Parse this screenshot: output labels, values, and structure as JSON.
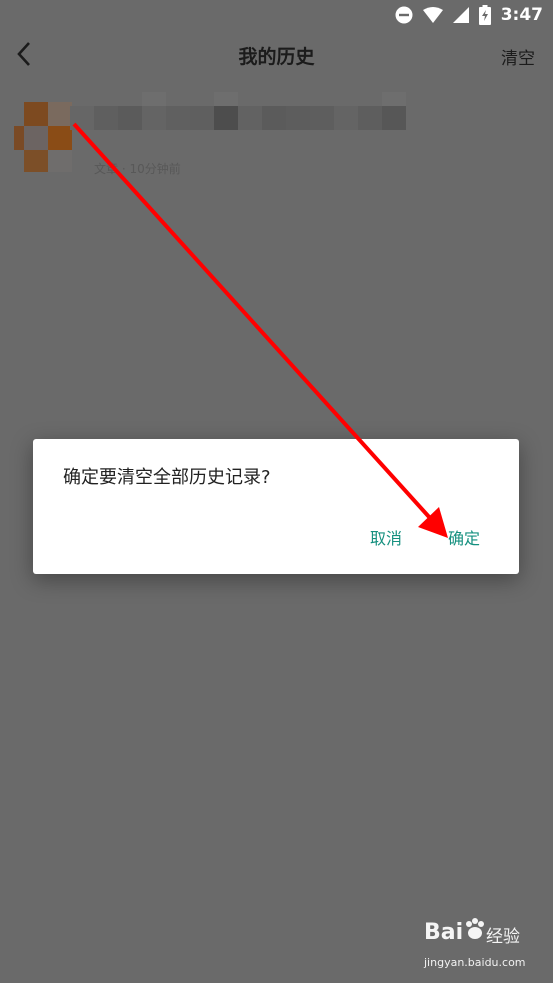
{
  "status_bar": {
    "time": "3:47"
  },
  "header": {
    "title": "我的历史",
    "clear_label": "清空"
  },
  "history_item": {
    "meta": "文章 · 10分钟前"
  },
  "dialog": {
    "message": "确定要清空全部历史记录?",
    "cancel_label": "取消",
    "confirm_label": "确定"
  },
  "watermark": {
    "logo_text": "Bai",
    "logo_text_2": "经验",
    "url": "jingyan.baidu.com"
  }
}
